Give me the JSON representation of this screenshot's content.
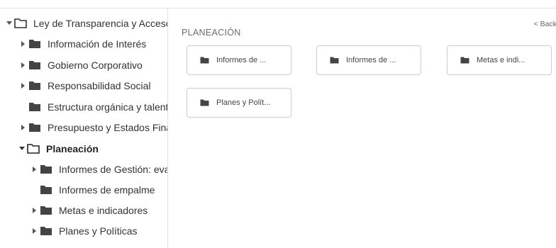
{
  "tree": {
    "root": {
      "label": "Ley de Transparencia y Acceso"
    },
    "items": [
      {
        "label": "Información de Interés"
      },
      {
        "label": "Gobierno Corporativo"
      },
      {
        "label": "Responsabilidad Social"
      },
      {
        "label": "Estructura orgánica y talento"
      },
      {
        "label": "Presupuesto y Estados Financieros"
      },
      {
        "label": "Planeación"
      }
    ],
    "subitems": [
      {
        "label": "Informes de Gestión: evaluación"
      },
      {
        "label": "Informes de empalme"
      },
      {
        "label": "Metas e indicadores"
      },
      {
        "label": "Planes y Políticas"
      }
    ]
  },
  "content": {
    "title": "PLANEACIÓN",
    "back_label": "< Back",
    "cards": [
      {
        "label": "Informes de ..."
      },
      {
        "label": "Informes de ..."
      },
      {
        "label": "Metas e indi..."
      },
      {
        "label": "Planes y Polít..."
      }
    ]
  },
  "colors": {
    "folder_fill": "#444444",
    "border": "#cccccc",
    "text": "#333333"
  }
}
